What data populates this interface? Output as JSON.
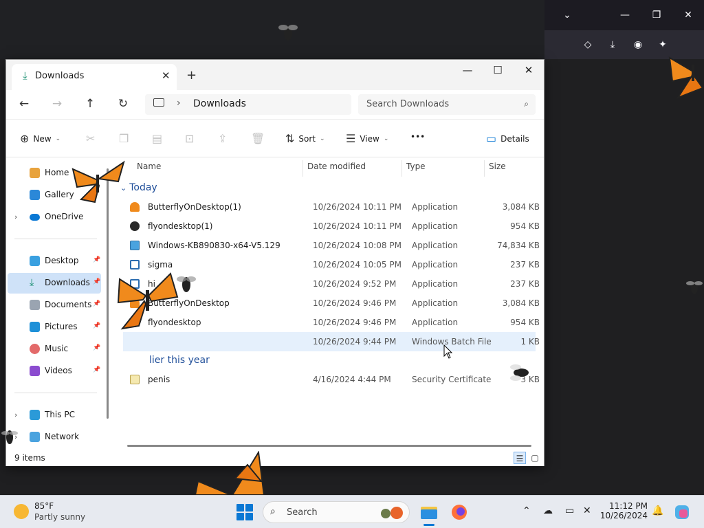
{
  "window": {
    "tab_title": "Downloads",
    "tab_close": "✕",
    "new_tab": "+",
    "minimize": "—",
    "maximize": "☐",
    "close": "✕"
  },
  "nav": {
    "back": "←",
    "forward": "→",
    "up": "↑",
    "refresh": "↻",
    "breadcrumb_sep": "›",
    "breadcrumb_current": "Downloads",
    "search_placeholder": "Search Downloads"
  },
  "toolbar": {
    "new_label": "New",
    "sort_label": "Sort",
    "view_label": "View",
    "more_label": "•••",
    "details_label": "Details"
  },
  "sidebar": {
    "items": [
      {
        "label": "Home",
        "icon": "home-icon"
      },
      {
        "label": "Gallery",
        "icon": "gallery-icon"
      },
      {
        "label": "OneDrive",
        "icon": "onedrive-icon"
      },
      {
        "label": "Desktop",
        "icon": "desktop-icon"
      },
      {
        "label": "Downloads",
        "icon": "download-icon"
      },
      {
        "label": "Documents",
        "icon": "documents-icon"
      },
      {
        "label": "Pictures",
        "icon": "pictures-icon"
      },
      {
        "label": "Music",
        "icon": "music-icon"
      },
      {
        "label": "Videos",
        "icon": "videos-icon"
      },
      {
        "label": "This PC",
        "icon": "pc-icon"
      },
      {
        "label": "Network",
        "icon": "network-icon"
      }
    ]
  },
  "columns": {
    "name": "Name",
    "date": "Date modified",
    "type": "Type",
    "size": "Size"
  },
  "groups": {
    "today": "Today",
    "earlier": "lier this year"
  },
  "files": [
    {
      "name": "ButterflyOnDesktop(1)",
      "date": "10/26/2024 10:11 PM",
      "type": "Application",
      "size": "3,084 KB"
    },
    {
      "name": "flyondesktop(1)",
      "date": "10/26/2024 10:11 PM",
      "type": "Application",
      "size": "954 KB"
    },
    {
      "name": "Windows-KB890830-x64-V5.129",
      "date": "10/26/2024 10:08 PM",
      "type": "Application",
      "size": "74,834 KB"
    },
    {
      "name": "sigma",
      "date": "10/26/2024 10:05 PM",
      "type": "Application",
      "size": "237 KB"
    },
    {
      "name": "hi",
      "date": "10/26/2024 9:52 PM",
      "type": "Application",
      "size": "237 KB"
    },
    {
      "name": "ButterflyOnDesktop",
      "date": "10/26/2024 9:46 PM",
      "type": "Application",
      "size": "3,084 KB"
    },
    {
      "name": "flyondesktop",
      "date": "10/26/2024 9:46 PM",
      "type": "Application",
      "size": "954 KB"
    },
    {
      "name": "",
      "date": "10/26/2024 9:44 PM",
      "type": "Windows Batch File",
      "size": "1 KB"
    }
  ],
  "earlier_files": [
    {
      "name": "penis",
      "date": "4/16/2024 4:44 PM",
      "type": "Security Certificate",
      "size": "3 KB"
    }
  ],
  "status": {
    "item_count": "9 items"
  },
  "taskbar": {
    "weather_temp": "85°F",
    "weather_desc": "Partly sunny",
    "search_label": "Search",
    "time": "11:12 PM",
    "date": "10/26/2024"
  },
  "colors": {
    "accent": "#0a78d4",
    "selection": "#cfe2f8",
    "row_highlight": "#e5f0fc",
    "butterfly": "#f08a1c"
  }
}
